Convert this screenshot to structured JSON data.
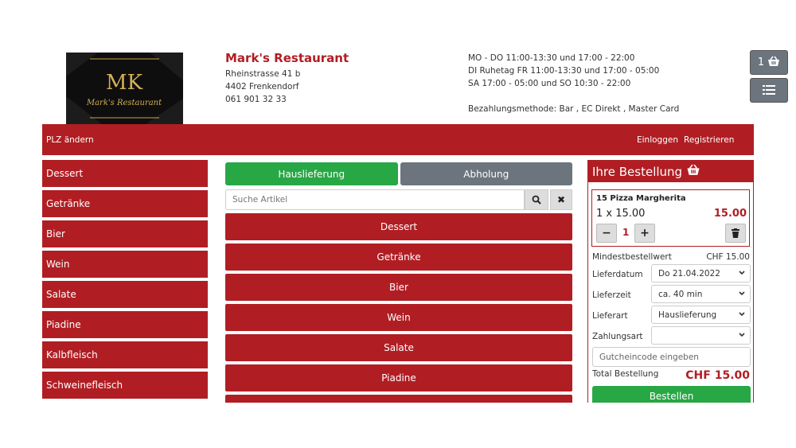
{
  "restaurant": {
    "logo_text": "Mark's Restaurant",
    "logo_monogram": "MK",
    "name": "Mark's Restaurant",
    "street": "Rheinstrasse 41 b",
    "city": "4402 Frenkendorf",
    "phone": "061 901 32 33"
  },
  "hours": {
    "line1": "MO - DO 11:00-13:30 und 17:00 - 22:00",
    "line2": "DI Ruhetag FR 11:00-13:30 und 17:00 - 05:00",
    "line3": "SA 17:00 - 05:00 und SO 10:30 - 22:00",
    "payment": "Bezahlungsmethode: Bar , EC Direkt , Master Card"
  },
  "cart_count": "1",
  "topbar": {
    "plz": "PLZ ändern",
    "login": "Einloggen",
    "register": "Registrieren"
  },
  "sidebar": {
    "items": [
      "Dessert",
      "Getränke",
      "Bier",
      "Wein",
      "Salate",
      "Piadine",
      "Kalbfleisch",
      "Schweinefleisch"
    ]
  },
  "center": {
    "delivery_label": "Hauslieferung",
    "pickup_label": "Abholung",
    "search_placeholder": "Suche Artikel",
    "clear_label": "✖",
    "categories": [
      "Dessert",
      "Getränke",
      "Bier",
      "Wein",
      "Salate",
      "Piadine",
      ""
    ]
  },
  "order": {
    "title": "Ihre Bestellung",
    "item_name": "15 Pizza Margherita",
    "item_qty_price": "1 x 15.00",
    "item_total": "15.00",
    "quantity": "1",
    "minus_label": "−",
    "plus_label": "+",
    "min_label": "Mindestbestellwert",
    "min_value": "CHF 15.00",
    "date_label": "Lieferdatum",
    "date_value": "Do 21.04.2022",
    "time_label": "Lieferzeit",
    "time_value": "ca. 40 min",
    "type_label": "Lieferart",
    "type_value": "Hauslieferung",
    "pay_label": "Zahlungsart",
    "pay_value": "",
    "coupon_placeholder": "Gutcheincode eingeben",
    "total_label": "Total Bestellung",
    "total_value": "CHF 15.00",
    "order_button": "Bestellen"
  },
  "colors": {
    "brand_red": "#b01e23",
    "green": "#28a745",
    "gray": "#6c757d"
  }
}
